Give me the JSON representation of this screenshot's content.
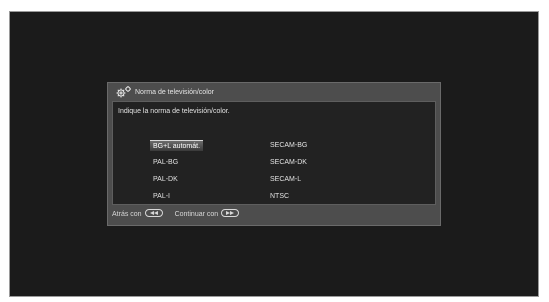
{
  "dialog": {
    "title": "Norma de televisión/color",
    "prompt": "Indique la norma de televisión/color.",
    "selected": "BG+L automát.",
    "options_left": [
      "BG+L automát.",
      "PAL-BG",
      "PAL-DK",
      "PAL-I"
    ],
    "options_right": [
      "SECAM-BG",
      "SECAM-DK",
      "SECAM-L",
      "NTSC"
    ]
  },
  "footer": {
    "back_label": "Atrás con",
    "back_icon": "rewind-key-icon",
    "continue_label": "Continuar con",
    "continue_icon": "fast-forward-key-icon"
  },
  "colors": {
    "screen_background": "#1b1b1b",
    "dialog_background": "#4d4d4d",
    "content_background": "#222222",
    "text": "#e2e2e2"
  }
}
